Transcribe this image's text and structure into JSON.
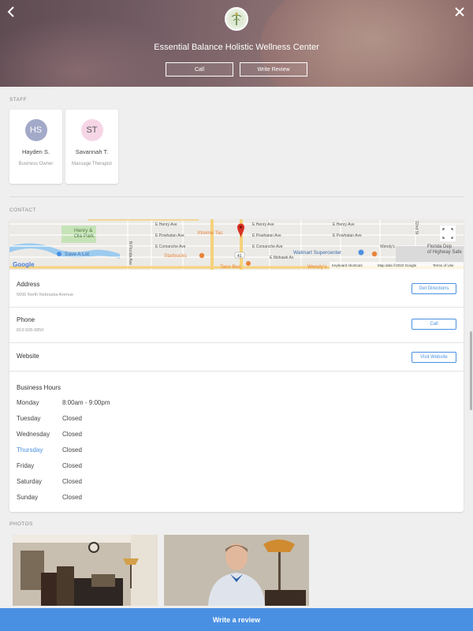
{
  "header": {
    "business_name": "Essential Balance Holistic Wellness Center",
    "call_label": "Call",
    "write_review_label": "Write Review",
    "back_icon": "chevron-left-icon",
    "close_icon": "close-icon"
  },
  "staff": {
    "section_label": "STAFF",
    "members": [
      {
        "initials": "HS",
        "name": "Hayden S.",
        "role": "Business Owner",
        "avatar_color": "#a3a9c9"
      },
      {
        "initials": "ST",
        "name": "Savannah T.",
        "role": "Massage Therapist",
        "avatar_color": "#f6d6e6"
      }
    ]
  },
  "contact": {
    "section_label": "CONTACT",
    "map": {
      "streets": [
        "E Henry Ave",
        "E Powhatan Ave",
        "E Comanche Ave",
        "E Mohawk Av",
        "E Henry Ave",
        "E Powhatan Ave",
        "E Comanche Ave",
        "E Henry Ave",
        "E Powhatan Ave",
        "N Florida Ave",
        "22nd St"
      ],
      "places": [
        "Henry & Ola Park",
        "Save A Lot",
        "Xtreme Tac",
        "Starbucks",
        "Walmart Supercenter",
        "Taco Bus",
        "Wendy's",
        "Florida Dep of Highway Safe"
      ],
      "route_badge": "41",
      "attribution": [
        "Google",
        "Keyboard shortcuts",
        "Map data ©2022 Google",
        "Terms of Use"
      ],
      "fullscreen_icon": "fullscreen-icon"
    },
    "address": {
      "title": "Address",
      "value": "5606 North Nebraska Avenue",
      "button": "Get Directions"
    },
    "phone": {
      "title": "Phone",
      "value": "813-928-9850",
      "button": "Call"
    },
    "website": {
      "title": "Website",
      "button": "Visit Website"
    },
    "hours": {
      "title": "Business Hours",
      "days": [
        {
          "day": "Monday",
          "time": "8:00am - 9:00pm"
        },
        {
          "day": "Tuesday",
          "time": "Closed"
        },
        {
          "day": "Wednesday",
          "time": "Closed"
        },
        {
          "day": "Thursday",
          "time": "Closed"
        },
        {
          "day": "Friday",
          "time": "Closed"
        },
        {
          "day": "Saturday",
          "time": "Closed"
        },
        {
          "day": "Sunday",
          "time": "Closed"
        }
      ],
      "today_color": "#4a90e2"
    }
  },
  "photos": {
    "section_label": "PHOTOS"
  },
  "footer": {
    "write_review_label": "Write a review"
  },
  "colors": {
    "accent": "#4a90e2"
  }
}
